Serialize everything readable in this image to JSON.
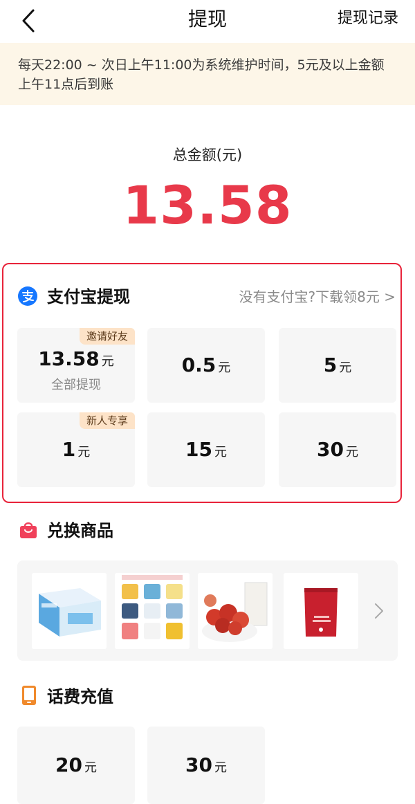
{
  "header": {
    "title": "提现",
    "records_label": "提现记录"
  },
  "notice": "每天22:00 ~ 次日上午11:00为系统维护时间，5元及以上金额上午11点后到账",
  "total": {
    "label": "总金额(元)",
    "amount": "13.58"
  },
  "alipay": {
    "title": "支付宝提现",
    "link": "没有支付宝?下载领8元 >",
    "options": [
      {
        "amount": "13.58",
        "unit": "元",
        "sub": "全部提现",
        "tag": "邀请好友"
      },
      {
        "amount": "0.5",
        "unit": "元"
      },
      {
        "amount": "5",
        "unit": "元"
      },
      {
        "amount": "1",
        "unit": "元",
        "tag": "新人专享"
      },
      {
        "amount": "15",
        "unit": "元"
      },
      {
        "amount": "30",
        "unit": "元"
      }
    ]
  },
  "exchange": {
    "title": "兑换商品"
  },
  "recharge": {
    "title": "话费充值",
    "options": [
      {
        "amount": "20",
        "unit": "元"
      },
      {
        "amount": "30",
        "unit": "元"
      }
    ]
  },
  "colors": {
    "accent": "#e8394a",
    "highlight_border": "#e8233a",
    "alipay_blue": "#1677ff",
    "notice_bg": "#fdf6e8",
    "tag_bg": "#fde3c8",
    "recharge_orange": "#f08a2c"
  }
}
